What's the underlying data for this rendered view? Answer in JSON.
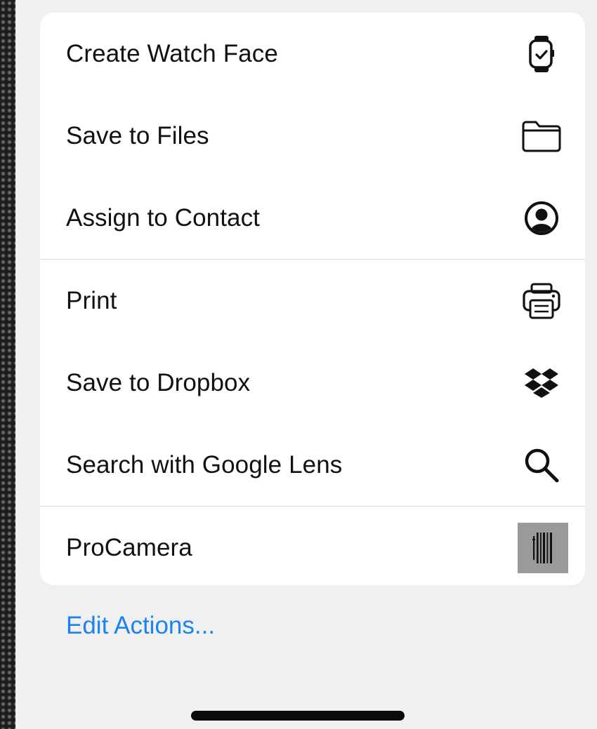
{
  "actions": {
    "create_watch_face": "Create Watch Face",
    "save_to_files": "Save to Files",
    "assign_to_contact": "Assign to Contact",
    "print": "Print",
    "save_to_dropbox": "Save to Dropbox",
    "search_google_lens": "Search with Google Lens",
    "procamera": "ProCamera"
  },
  "footer": {
    "edit_actions": "Edit Actions..."
  },
  "icons": {
    "create_watch_face": "watch-icon",
    "save_to_files": "folder-icon",
    "assign_to_contact": "person-circle-icon",
    "print": "printer-icon",
    "save_to_dropbox": "dropbox-icon",
    "search_google_lens": "magnifying-glass-icon",
    "procamera": "procamera-app-icon"
  },
  "colors": {
    "link": "#1a82f2",
    "card": "#ffffff",
    "sheet": "#f0f0f0"
  }
}
